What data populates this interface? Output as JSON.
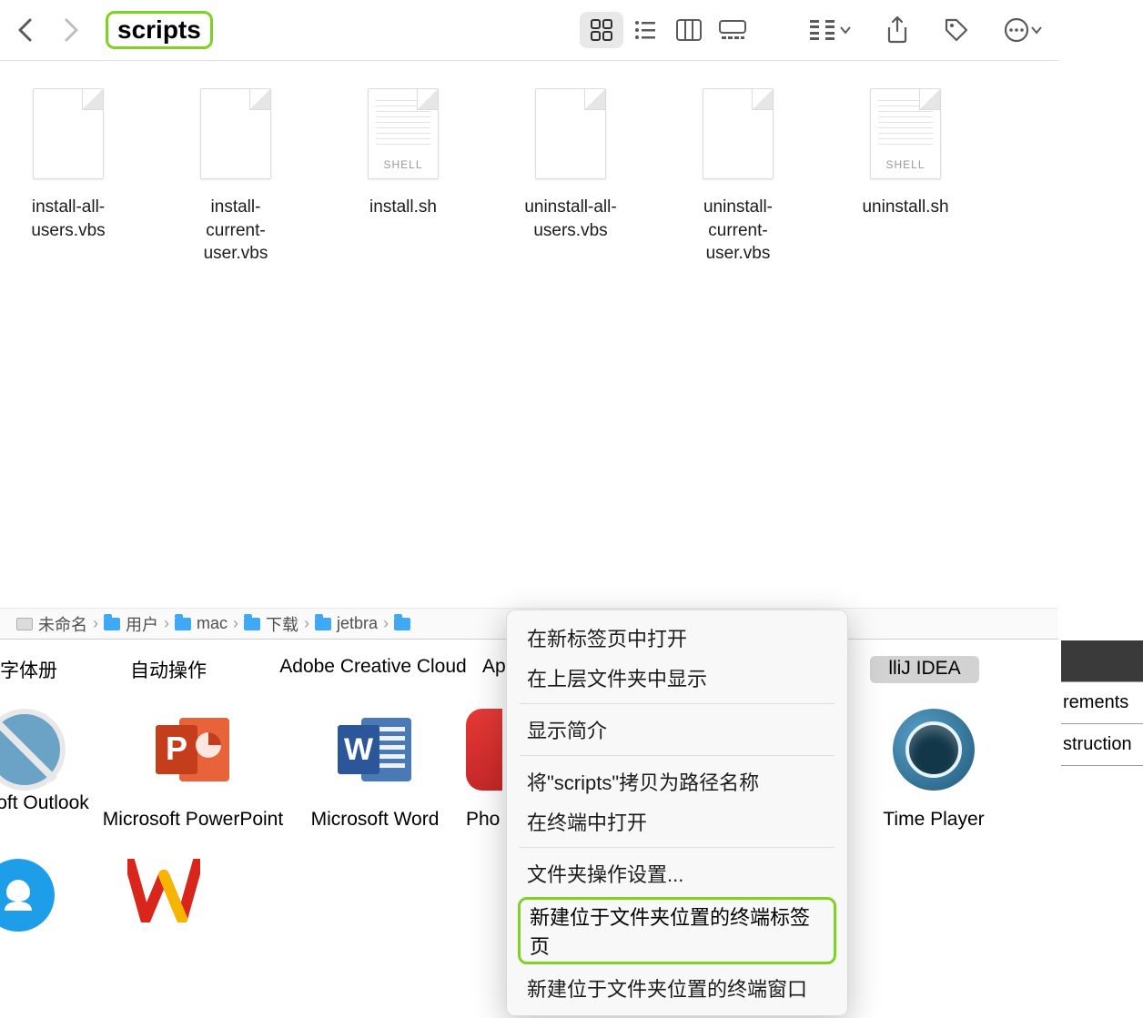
{
  "toolbar": {
    "folder_title": "scripts"
  },
  "files": [
    {
      "name": "install-all-users.vbs",
      "type": "vbs"
    },
    {
      "name": "install-current-user.vbs",
      "type": "vbs"
    },
    {
      "name": "install.sh",
      "type": "shell",
      "badge": "SHELL"
    },
    {
      "name": "uninstall-all-users.vbs",
      "type": "vbs"
    },
    {
      "name": "uninstall-current-user.vbs",
      "type": "vbs"
    },
    {
      "name": "uninstall.sh",
      "type": "shell",
      "badge": "SHELL"
    }
  ],
  "path": {
    "segments": [
      "未命名",
      "用户",
      "mac",
      "下载",
      "jetbra"
    ]
  },
  "bg_apps_row1": {
    "a0": "字体册",
    "a1": "自动操作",
    "a2": "Adobe Creative Cloud",
    "a3": "Ap",
    "a4": "lliJ IDEA"
  },
  "bg_apps_row2": {
    "outlook": "oft Outlook",
    "powerpoint": "Microsoft PowerPoint",
    "word": "Microsoft Word",
    "pho": "Pho",
    "quicktime": "Time Player"
  },
  "right_panel": {
    "r0": "rements",
    "r1": "struction"
  },
  "context_menu": {
    "open_new_tab": "在新标签页中打开",
    "show_parent": "在上层文件夹中显示",
    "get_info": "显示简介",
    "copy_path": "将\"scripts\"拷贝为路径名称",
    "open_terminal": "在终端中打开",
    "folder_actions": "文件夹操作设置...",
    "new_term_tab": "新建位于文件夹位置的终端标签页",
    "new_term_window": "新建位于文件夹位置的终端窗口"
  }
}
